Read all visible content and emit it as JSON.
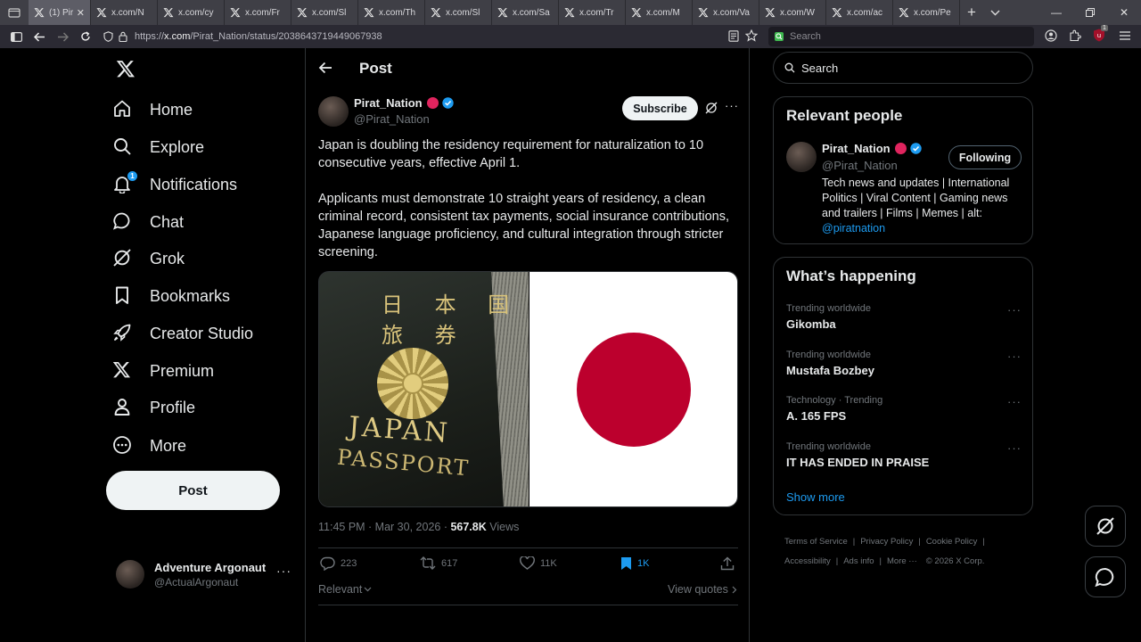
{
  "browser": {
    "tabs": [
      {
        "label": "(1) Pir",
        "active": true
      },
      {
        "label": "x.com/N"
      },
      {
        "label": "x.com/cy"
      },
      {
        "label": "x.com/Fr"
      },
      {
        "label": "x.com/Sl"
      },
      {
        "label": "x.com/Th"
      },
      {
        "label": "x.com/Sl"
      },
      {
        "label": "x.com/Sa"
      },
      {
        "label": "x.com/Tr"
      },
      {
        "label": "x.com/M"
      },
      {
        "label": "x.com/Va"
      },
      {
        "label": "x.com/W"
      },
      {
        "label": "x.com/ac"
      },
      {
        "label": "x.com/Pe"
      }
    ],
    "url_prefix": "https://",
    "url_domain": "x.com",
    "url_path": "/Pirat_Nation/status/2038643719449067938",
    "search_placeholder": "Search",
    "extension_badge": "1"
  },
  "nav": {
    "items": [
      {
        "label": "Home",
        "icon": "home-icon"
      },
      {
        "label": "Explore",
        "icon": "search-icon"
      },
      {
        "label": "Notifications",
        "icon": "bell-icon",
        "badge": "1"
      },
      {
        "label": "Chat",
        "icon": "chat-icon"
      },
      {
        "label": "Grok",
        "icon": "grok-icon"
      },
      {
        "label": "Bookmarks",
        "icon": "bookmark-icon"
      },
      {
        "label": "Creator Studio",
        "icon": "rocket-icon"
      },
      {
        "label": "Premium",
        "icon": "x-logo-icon"
      },
      {
        "label": "Profile",
        "icon": "person-icon"
      },
      {
        "label": "More",
        "icon": "more-circle-icon"
      }
    ],
    "post_button": "Post",
    "account": {
      "name": "Adventure Argonaut",
      "handle": "@ActualArgonaut"
    }
  },
  "post": {
    "header_title": "Post",
    "author_name": "Pirat_Nation",
    "author_handle": "@Pirat_Nation",
    "subscribe_label": "Subscribe",
    "text_1": "Japan is doubling the residency requirement for naturalization to 10 consecutive years, effective April 1.",
    "text_2": "Applicants must demonstrate 10 straight years of residency, a clean criminal record, consistent tax payments, social insurance contributions, Japanese language proficiency, and cultural integration through stricter screening.",
    "passport_line_1": "JAPAN",
    "passport_line_2": "PASSPORT",
    "timestamp": "11:45 PM · Mar 30, 2026 · ",
    "views_count": "567.8K",
    "views_label": " Views",
    "replies": "223",
    "reposts": "617",
    "likes": "11K",
    "bookmarks": "1K",
    "sort_label": "Relevant",
    "view_quotes": "View quotes"
  },
  "sidebar": {
    "search_placeholder": "Search",
    "relevant_title": "Relevant people",
    "person": {
      "name": "Pirat_Nation",
      "handle": "@Pirat_Nation",
      "follow_label": "Following",
      "bio": "Tech news and updates | International Politics | Viral Content | Gaming news and trailers | Films | Memes | alt: ",
      "bio_link": "@piratnation"
    },
    "happening_title": "What’s happening",
    "trends": [
      {
        "meta": "Trending worldwide",
        "name": "Gikomba"
      },
      {
        "meta": "Trending worldwide",
        "name": "Mustafa Bozbey"
      },
      {
        "meta": "Technology · Trending",
        "name": "A. 165 FPS"
      },
      {
        "meta": "Trending worldwide",
        "name": "IT HAS ENDED IN PRAISE"
      }
    ],
    "show_more": "Show more",
    "footer": {
      "terms": "Terms of Service",
      "privacy": "Privacy Policy",
      "cookie": "Cookie Policy",
      "accessibility": "Accessibility",
      "ads": "Ads info",
      "more": "More ···",
      "copyright": "© 2026 X Corp."
    }
  },
  "colors": {
    "accent": "#1d9bf0",
    "badge_red": "#e0245e",
    "flag_red": "#bc002d"
  }
}
